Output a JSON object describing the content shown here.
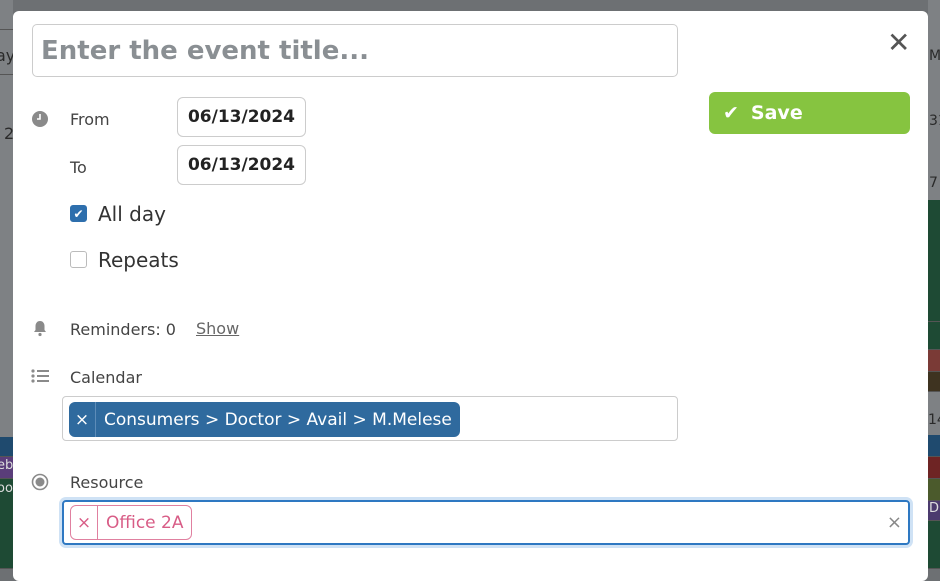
{
  "background": {
    "left_fragments": [
      "ay",
      "2",
      "eb",
      "oo"
    ],
    "right_fragments": [
      "M",
      "31",
      "7",
      "14",
      "D"
    ]
  },
  "event": {
    "title_placeholder": "Enter the event title...",
    "save_label": "Save",
    "from_label": "From",
    "from_date": "06/13/2024",
    "to_label": "To",
    "to_date": "06/13/2024",
    "all_day_label": "All day",
    "all_day_checked": true,
    "repeats_label": "Repeats",
    "repeats_checked": false,
    "reminders_label": "Reminders: 0",
    "reminders_show": "Show",
    "calendar_label": "Calendar",
    "calendar_value": "Consumers > Doctor > Avail > M.Melese",
    "resource_label": "Resource",
    "resource_value": "Office 2A",
    "remove_glyph": "×",
    "close_glyph": "✕"
  },
  "colors": {
    "save": "#86c440",
    "calendar_tag": "#2f6a9e",
    "resource_tag": "#d85c86",
    "focus": "#2e78c2"
  }
}
